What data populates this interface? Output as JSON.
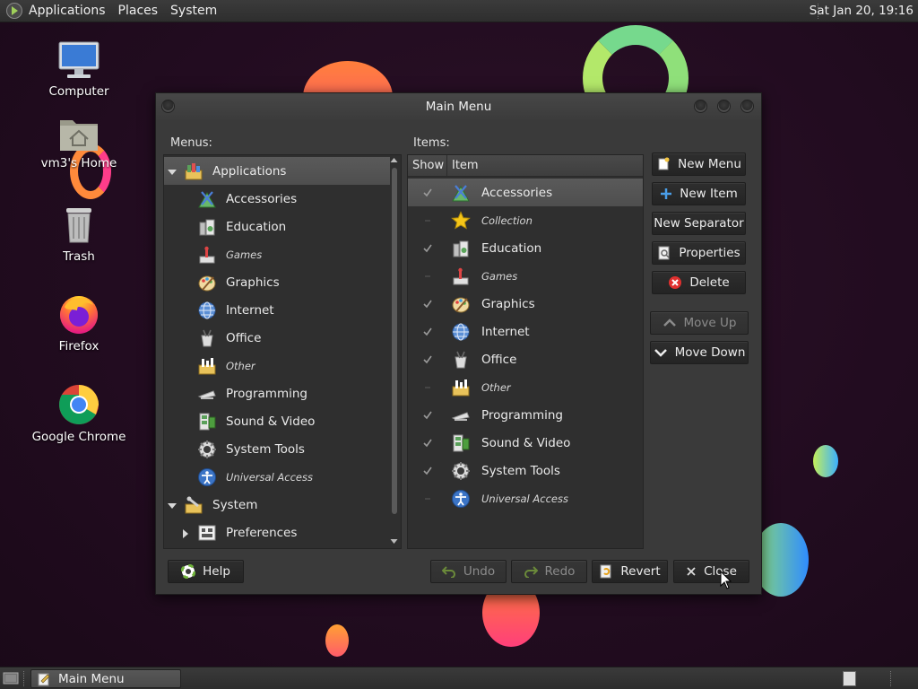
{
  "top_panel": {
    "menus": [
      "Applications",
      "Places",
      "System"
    ],
    "clock": "Sat Jan 20, 19:16"
  },
  "desktop_icons": [
    {
      "label": "Computer",
      "icon": "computer-icon"
    },
    {
      "label": "vm3's Home",
      "icon": "home-folder-icon"
    },
    {
      "label": "Trash",
      "icon": "trash-icon"
    },
    {
      "label": "Firefox",
      "icon": "firefox-icon"
    },
    {
      "label": "Google Chrome",
      "icon": "chrome-icon"
    }
  ],
  "window": {
    "title": "Main Menu",
    "menus_label": "Menus:",
    "items_label": "Items:",
    "menus_tree": [
      {
        "label": "Applications",
        "icon": "applications-icon",
        "level": 0,
        "expander": "expanded",
        "selected": true,
        "italic": false
      },
      {
        "label": "Accessories",
        "icon": "accessories-icon",
        "level": 1,
        "italic": false
      },
      {
        "label": "Education",
        "icon": "education-icon",
        "level": 1,
        "italic": false
      },
      {
        "label": "Games",
        "icon": "games-icon",
        "level": 1,
        "italic": true
      },
      {
        "label": "Graphics",
        "icon": "graphics-icon",
        "level": 1,
        "italic": false
      },
      {
        "label": "Internet",
        "icon": "internet-icon",
        "level": 1,
        "italic": false
      },
      {
        "label": "Office",
        "icon": "office-icon",
        "level": 1,
        "italic": false
      },
      {
        "label": "Other",
        "icon": "other-icon",
        "level": 1,
        "italic": true
      },
      {
        "label": "Programming",
        "icon": "programming-icon",
        "level": 1,
        "italic": false
      },
      {
        "label": "Sound & Video",
        "icon": "sound-video-icon",
        "level": 1,
        "italic": false
      },
      {
        "label": "System Tools",
        "icon": "system-tools-icon",
        "level": 1,
        "italic": false
      },
      {
        "label": "Universal Access",
        "icon": "universal-access-icon",
        "level": 1,
        "italic": true
      },
      {
        "label": "System",
        "icon": "system-icon",
        "level": 0,
        "expander": "expanded",
        "italic": false
      },
      {
        "label": "Preferences",
        "icon": "preferences-icon",
        "level": 1,
        "expander": "collapsed",
        "italic": false
      }
    ],
    "items_columns": [
      "Show",
      "Item"
    ],
    "items": [
      {
        "label": "Accessories",
        "icon": "accessories-icon",
        "show": true,
        "selected": true,
        "italic": false
      },
      {
        "label": "Collection",
        "icon": "star-icon",
        "show": false,
        "italic": true
      },
      {
        "label": "Education",
        "icon": "education-icon",
        "show": true,
        "italic": false
      },
      {
        "label": "Games",
        "icon": "games-icon",
        "show": false,
        "italic": true
      },
      {
        "label": "Graphics",
        "icon": "graphics-icon",
        "show": true,
        "italic": false
      },
      {
        "label": "Internet",
        "icon": "internet-icon",
        "show": true,
        "italic": false
      },
      {
        "label": "Office",
        "icon": "office-icon",
        "show": true,
        "italic": false
      },
      {
        "label": "Other",
        "icon": "other-icon",
        "show": false,
        "italic": true
      },
      {
        "label": "Programming",
        "icon": "programming-icon",
        "show": true,
        "italic": false
      },
      {
        "label": "Sound & Video",
        "icon": "sound-video-icon",
        "show": true,
        "italic": false
      },
      {
        "label": "System Tools",
        "icon": "system-tools-icon",
        "show": true,
        "italic": false
      },
      {
        "label": "Universal Access",
        "icon": "universal-access-icon",
        "show": false,
        "italic": true
      }
    ],
    "buttons": {
      "new_menu": "New Menu",
      "new_item": "New Item",
      "new_separator": "New Separator",
      "properties": "Properties",
      "delete": "Delete",
      "move_up": "Move Up",
      "move_down": "Move Down",
      "help": "Help",
      "undo": "Undo",
      "redo": "Redo",
      "revert": "Revert",
      "close": "Close"
    }
  },
  "taskbar": {
    "task_label": "Main Menu"
  }
}
